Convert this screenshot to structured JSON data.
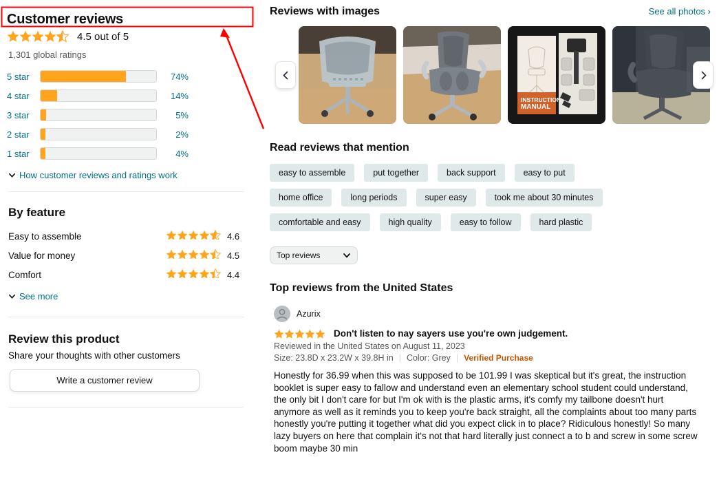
{
  "left": {
    "title": "Customer reviews",
    "overall_rating_text": "4.5 out of 5",
    "overall_rating_value": 4.5,
    "global_ratings": "1,301 global ratings",
    "histogram": [
      {
        "label": "5 star",
        "pct_text": "74%",
        "pct": 74
      },
      {
        "label": "4 star",
        "pct_text": "14%",
        "pct": 14
      },
      {
        "label": "3 star",
        "pct_text": "5%",
        "pct": 5
      },
      {
        "label": "2 star",
        "pct_text": "2%",
        "pct": 2
      },
      {
        "label": "1 star",
        "pct_text": "4%",
        "pct": 4
      }
    ],
    "how_reviews_work": "How customer reviews and ratings work",
    "by_feature_title": "By feature",
    "features": [
      {
        "name": "Easy to assemble",
        "score_text": "4.6",
        "score": 4.6
      },
      {
        "name": "Value for money",
        "score_text": "4.5",
        "score": 4.5
      },
      {
        "name": "Comfort",
        "score_text": "4.4",
        "score": 4.4
      }
    ],
    "see_more": "See more",
    "review_product_title": "Review this product",
    "share_thoughts": "Share your thoughts with other customers",
    "write_review_button": "Write a customer review"
  },
  "right": {
    "images_title": "Reviews with images",
    "see_all_photos": "See all photos ›",
    "thumbnails": [
      {
        "alt": "mesh-back-office-chair-on-wood-floor"
      },
      {
        "alt": "grey-office-chair-with-armrests"
      },
      {
        "alt": "instruction-manual-and-hardware-parts"
      },
      {
        "alt": "dark-office-chair-on-tile-floor"
      }
    ],
    "carousel_prev_icon": "chevron-left-icon",
    "carousel_next_icon": "chevron-right-icon",
    "mention_title": "Read reviews that mention",
    "tags": [
      "easy to assemble",
      "put together",
      "back support",
      "easy to put",
      "home office",
      "long periods",
      "super easy",
      "took me about 30 minutes",
      "comfortable and easy",
      "high quality",
      "easy to follow",
      "hard plastic"
    ],
    "sort_value": "Top reviews",
    "top_reviews_title": "Top reviews from the United States",
    "review": {
      "author": "Azurix",
      "rating": 5,
      "headline": "Don't listen to nay sayers use you're own judgement.",
      "date": "Reviewed in the United States on August 11, 2023",
      "size": "Size: 23.8D x 23.2W x 39.8H in",
      "color": "Color: Grey",
      "verified": "Verified Purchase",
      "body": "Honestly for 36.99 when this was supposed to be 101.99 I was skeptical but it's great, the instruction booklet is super easy to fallow and understand even an elementary school student could understand, the only bit I don't care for but I'm ok with is the plastic arms, it's comfy my tailbone doesn't hurt anymore as well as it reminds you to keep you're back straight, all the complaints about too many parts honestly you're putting it together what did you expect click in to place? Ridiculous honestly! So many lazy buyers on here that complain it's not that hard literally just connect a to b and screw in some screw boom maybe 30 min"
    }
  },
  "annotation": {
    "highlight_color": "#ff0000",
    "arrow_color": "#ff0000"
  },
  "colors": {
    "star": "#ffa41c",
    "link": "#007185",
    "bar_fill": "#ffa41c",
    "bar_track": "#f0f2f2",
    "tag_bg": "#dfe9ea",
    "verified": "#c45500"
  }
}
